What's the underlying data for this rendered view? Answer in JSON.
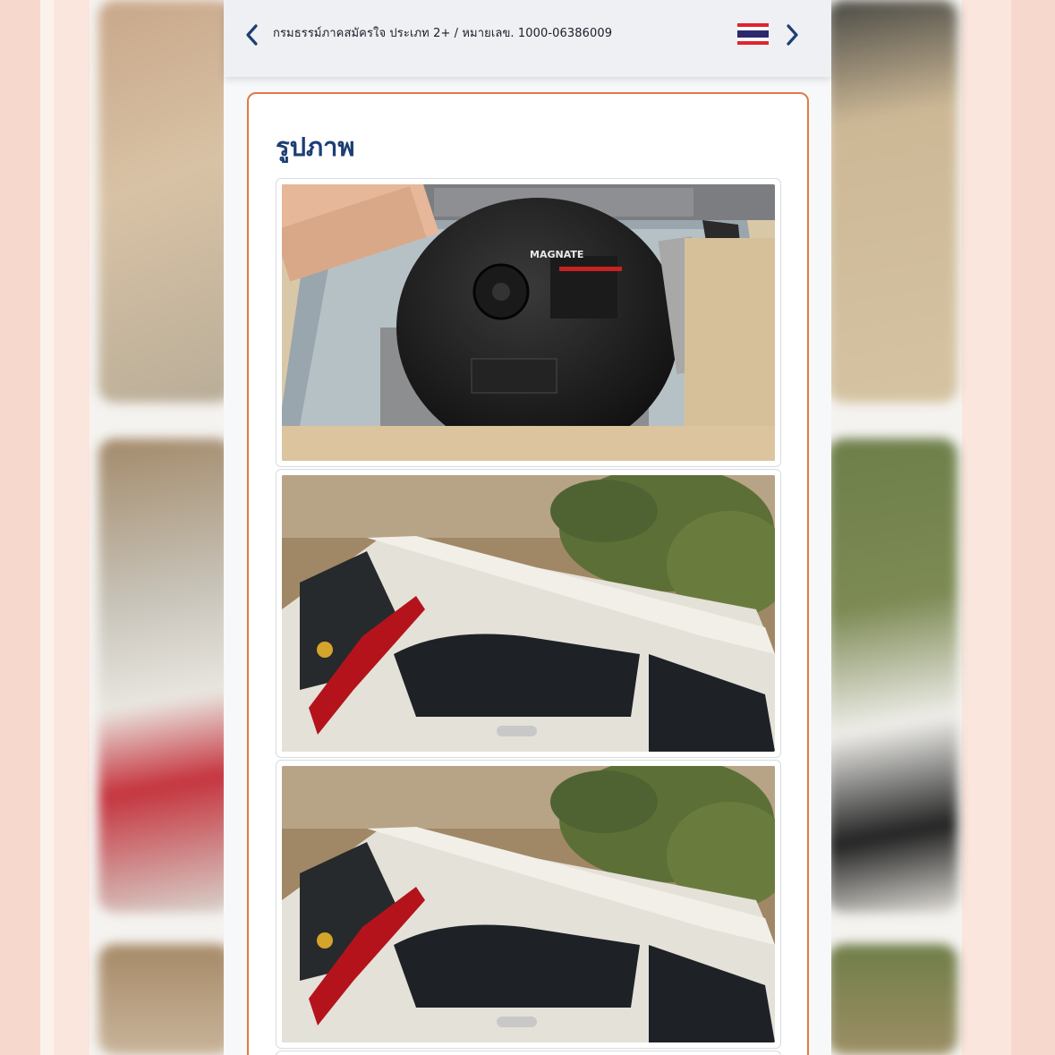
{
  "header": {
    "breadcrumb": "กรมธรรม์ภาคสมัครใจ ประเภท 2+ / หมายเลข. 1000-06386009",
    "prev_icon": "chevron-left-icon",
    "next_icon": "chevron-right-icon",
    "language_flag": "thailand-flag",
    "colors": {
      "nav": "#1d3e73",
      "flag_red": "#e0242f",
      "flag_blue": "#2c2a6d"
    }
  },
  "section": {
    "title": "รูปภาพ",
    "border_color": "#e27a44",
    "title_color": "#1d3e73"
  },
  "photos": [
    {
      "subject": "lpg-tank-in-trunk",
      "print": "MAGNATE"
    },
    {
      "subject": "white-suv-rear-side"
    },
    {
      "subject": "white-suv-rear-side"
    }
  ]
}
